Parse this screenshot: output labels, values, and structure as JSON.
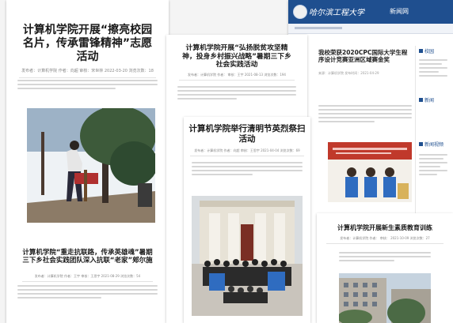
{
  "card1": {
    "title": "计算机学院开展“擦亮校园名片，传承雷锋精神”志愿活动",
    "meta": "发布者：计算机学院  作者：向超  审核：宋世林  2022-03-20  浏览次数：18",
    "second_title": "计算机学院“重走抗联路，传承英雄魂”暑期三下乡社会实践团队深入抗联“老家”郏尔施",
    "second_meta": "发布者：计算机学院  作者：王宇  审核：王思宇  2021-08-29  浏览次数：54"
  },
  "card2": {
    "title": "计算机学院开展“弘扬脱贫攻坚精神，投身乡村振兴战略”暑期三下乡社会实践活动",
    "meta": "发布者：计算机学院  作者：  审核：王宇  2021-08-13  浏览次数：194"
  },
  "card3": {
    "header_brand": "哈尔滨工程大学",
    "header_sub": "新闻网",
    "article_title": "我校荣获2020CPC国际大学生程序设计竞赛亚洲区域赛金奖",
    "meta": "来源：计算机学院  发布时间：2021-04-29",
    "sidebar_links": [
      "校园",
      "新闻",
      "新闻视频"
    ]
  },
  "card4": {
    "title": "计算机学院举行清明节英烈祭扫活动",
    "meta": "发布者：计算机学院  作者：向超  审核：王思宇  2021-04-04  浏览次数：69"
  },
  "card5": {
    "title": "计算机学院开展新生素质教育训练",
    "meta": "发布者：计算机学院  作者：  审核：  2021-10-09  浏览次数：27"
  },
  "colors": {
    "header_blue": "#1f4f8f",
    "banner_blue": "#2f6cc0",
    "banner_red": "#c0392b"
  }
}
